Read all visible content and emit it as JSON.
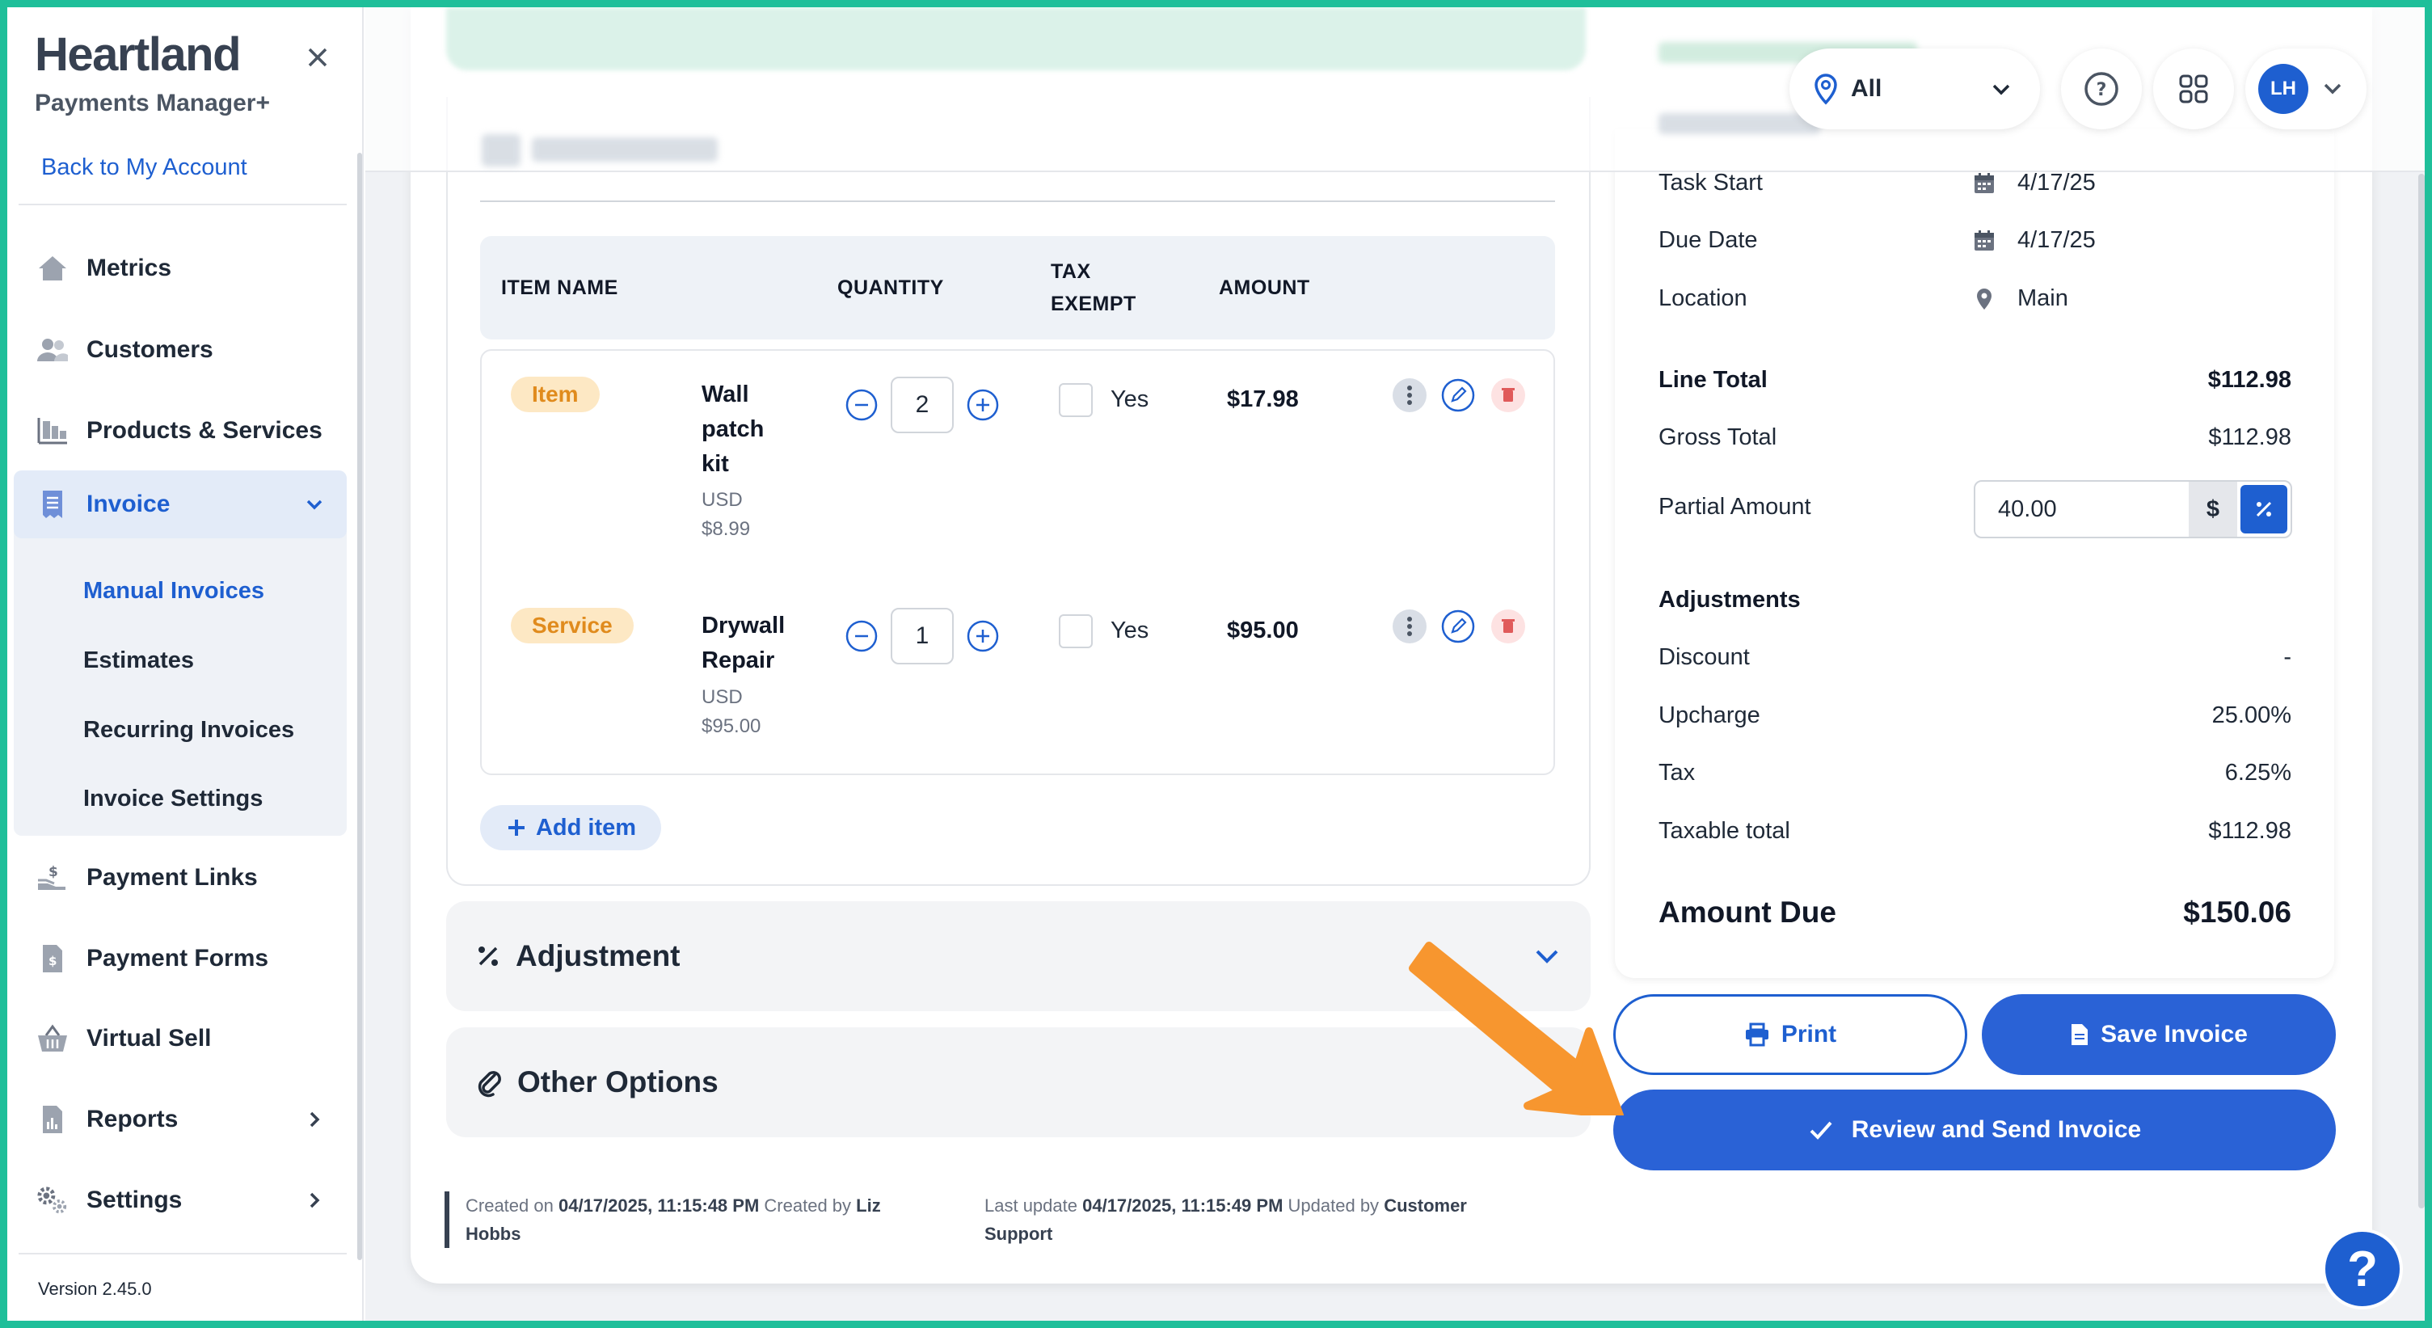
{
  "brand": {
    "name": "Heartland",
    "subtitle": "Payments Manager+",
    "back_link": "Back to My Account"
  },
  "sidebar": {
    "items": [
      {
        "label": "Metrics",
        "icon": "home-icon"
      },
      {
        "label": "Customers",
        "icon": "users-icon"
      },
      {
        "label": "Products & Services",
        "icon": "products-icon"
      },
      {
        "label": "Invoice",
        "icon": "invoice-icon",
        "expanded": true
      },
      {
        "label": "Payment Links",
        "icon": "payment-link-icon"
      },
      {
        "label": "Payment Forms",
        "icon": "payment-form-icon"
      },
      {
        "label": "Virtual Sell",
        "icon": "basket-icon"
      },
      {
        "label": "Reports",
        "icon": "reports-icon"
      },
      {
        "label": "Settings",
        "icon": "gear-icon"
      }
    ],
    "invoice_subitems": [
      "Manual Invoices",
      "Estimates",
      "Recurring Invoices",
      "Invoice Settings"
    ],
    "active_subitem": "Manual Invoices",
    "version": "Version 2.45.0"
  },
  "topbar": {
    "location": "All",
    "avatar_initials": "LH"
  },
  "items_table": {
    "headers": {
      "item_name": "ITEM NAME",
      "quantity": "QUANTITY",
      "tax_exempt_1": "TAX",
      "tax_exempt_2": "EXEMPT",
      "amount": "AMOUNT"
    },
    "rows": [
      {
        "type": "Item",
        "name_lines": [
          "Wall",
          "patch",
          "kit"
        ],
        "currency": "USD",
        "unit_price": "$8.99",
        "qty": "2",
        "tax_label": "Yes",
        "amount": "$17.98"
      },
      {
        "type": "Service",
        "name_lines": [
          "Drywall",
          "Repair"
        ],
        "currency": "USD",
        "unit_price": "$95.00",
        "qty": "1",
        "tax_label": "Yes",
        "amount": "$95.00"
      }
    ],
    "add_item": "Add item"
  },
  "panels": {
    "adjustment": "Adjustment",
    "other_options": "Other Options"
  },
  "meta": {
    "created_prefix": "Created on",
    "created_date": "04/17/2025, 11:15:48 PM",
    "created_by_prefix": "Created by",
    "created_by_1": "Liz",
    "created_by_2": "Hobbs",
    "updated_prefix": "Last update",
    "updated_date": "04/17/2025, 11:15:49 PM",
    "updated_by_prefix": "Updated by",
    "updated_by_1": "Customer",
    "updated_by_2": "Support"
  },
  "summary": {
    "task_start_label": "Task Start",
    "task_start": "4/17/25",
    "due_date_label": "Due Date",
    "due_date": "4/17/25",
    "location_label": "Location",
    "location": "Main",
    "line_total_label": "Line Total",
    "line_total": "$112.98",
    "gross_total_label": "Gross Total",
    "gross_total": "$112.98",
    "partial_label": "Partial Amount",
    "partial_value": "40.00",
    "partial_currency": "$",
    "adjustments_label": "Adjustments",
    "discount_label": "Discount",
    "discount": "-",
    "upcharge_label": "Upcharge",
    "upcharge": "25.00%",
    "tax_label": "Tax",
    "tax": "6.25%",
    "taxable_label": "Taxable total",
    "taxable": "$112.98",
    "amount_due_label": "Amount Due",
    "amount_due": "$150.06"
  },
  "actions": {
    "print": "Print",
    "save": "Save Invoice",
    "review": "Review and Send Invoice"
  },
  "colors": {
    "accent": "#1e5fd0",
    "frame": "#1fbf9a",
    "arrow": "#f7962f",
    "tag_bg": "#fde8c4",
    "tag_text": "#e08b1d"
  }
}
